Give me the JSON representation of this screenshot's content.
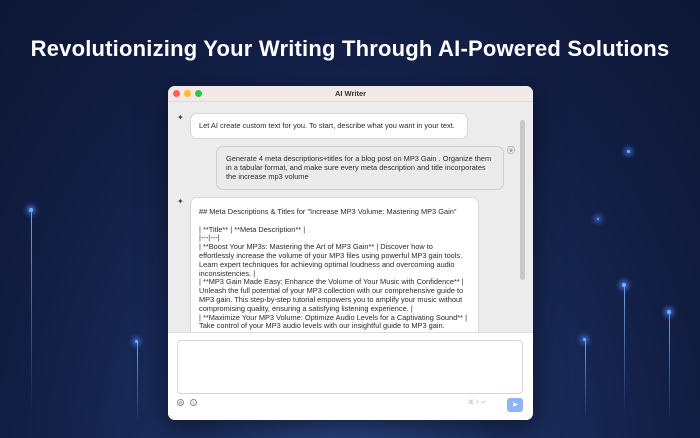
{
  "headline": "Revolutionizing Your Writing Through AI-Powered Solutions",
  "window": {
    "title": "AI Writer"
  },
  "messages": [
    {
      "role": "assistant",
      "text": "Let AI create custom text for you. To start, describe what you want in your text."
    },
    {
      "role": "user",
      "text": "Generate 4 meta descriptions+titles for a blog post on MP3 Gain . Organize them in a tabular format, and make sure every meta description and title incorporates the increase mp3 volume"
    },
    {
      "role": "assistant",
      "lines": [
        "## Meta Descriptions & Titles for \"Increase MP3 Volume: Mastering MP3 Gain\"",
        "",
        "| **Title** | **Meta Description** |",
        "|---|---|",
        "| **Boost Your MP3s: Mastering the Art of MP3 Gain** | Discover how to effortlessly increase the volume of your MP3 files using powerful MP3 gain tools. Learn expert techniques for achieving optimal loudness and overcoming audio inconsistencies. |",
        "| **MP3 Gain Made Easy: Enhance the Volume of Your Music with Confidence** | Unleash the full potential of your MP3 collection with our comprehensive guide to MP3 gain. This step-by-step tutorial empowers you to amplify your music without compromising quality, ensuring a satisfying listening experience. |",
        "| **Maximize Your MP3 Volume: Optimize Audio Levels for a Captivating Sound** | Take control of your MP3 audio levels with our insightful guide to MP3 gain."
      ]
    }
  ],
  "input": {
    "value": "",
    "shortcut": "⌘ + ↩",
    "send_icon": "paper-plane-icon"
  }
}
